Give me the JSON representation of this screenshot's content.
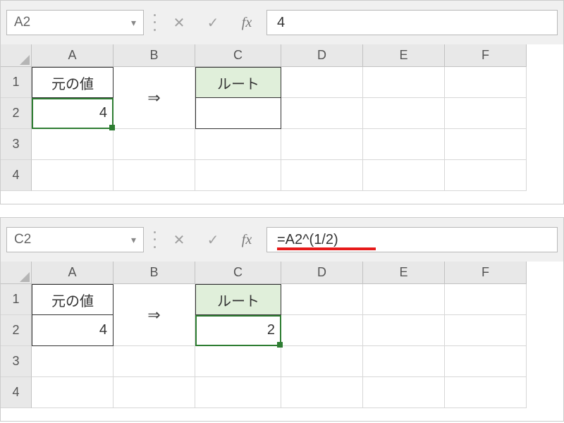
{
  "panels": {
    "top": {
      "nameBox": "A2",
      "formula": "4",
      "showUnderline": false,
      "selectedCell": "A2",
      "cells": {
        "A1": "元の値",
        "A2": "4",
        "B_arrow": "⇒",
        "C1": "ルート",
        "C2": ""
      }
    },
    "bottom": {
      "nameBox": "C2",
      "formula": "=A2^(1/2)",
      "showUnderline": true,
      "selectedCell": "C2",
      "cells": {
        "A1": "元の値",
        "A2": "4",
        "B_arrow": "⇒",
        "C1": "ルート",
        "C2": "2"
      }
    }
  },
  "columns": [
    "A",
    "B",
    "C",
    "D",
    "E",
    "F"
  ],
  "rows": [
    "1",
    "2",
    "3",
    "4"
  ],
  "icons": {
    "cancel": "✕",
    "enter": "✓",
    "fx": "fx",
    "dropdown": "▾"
  }
}
